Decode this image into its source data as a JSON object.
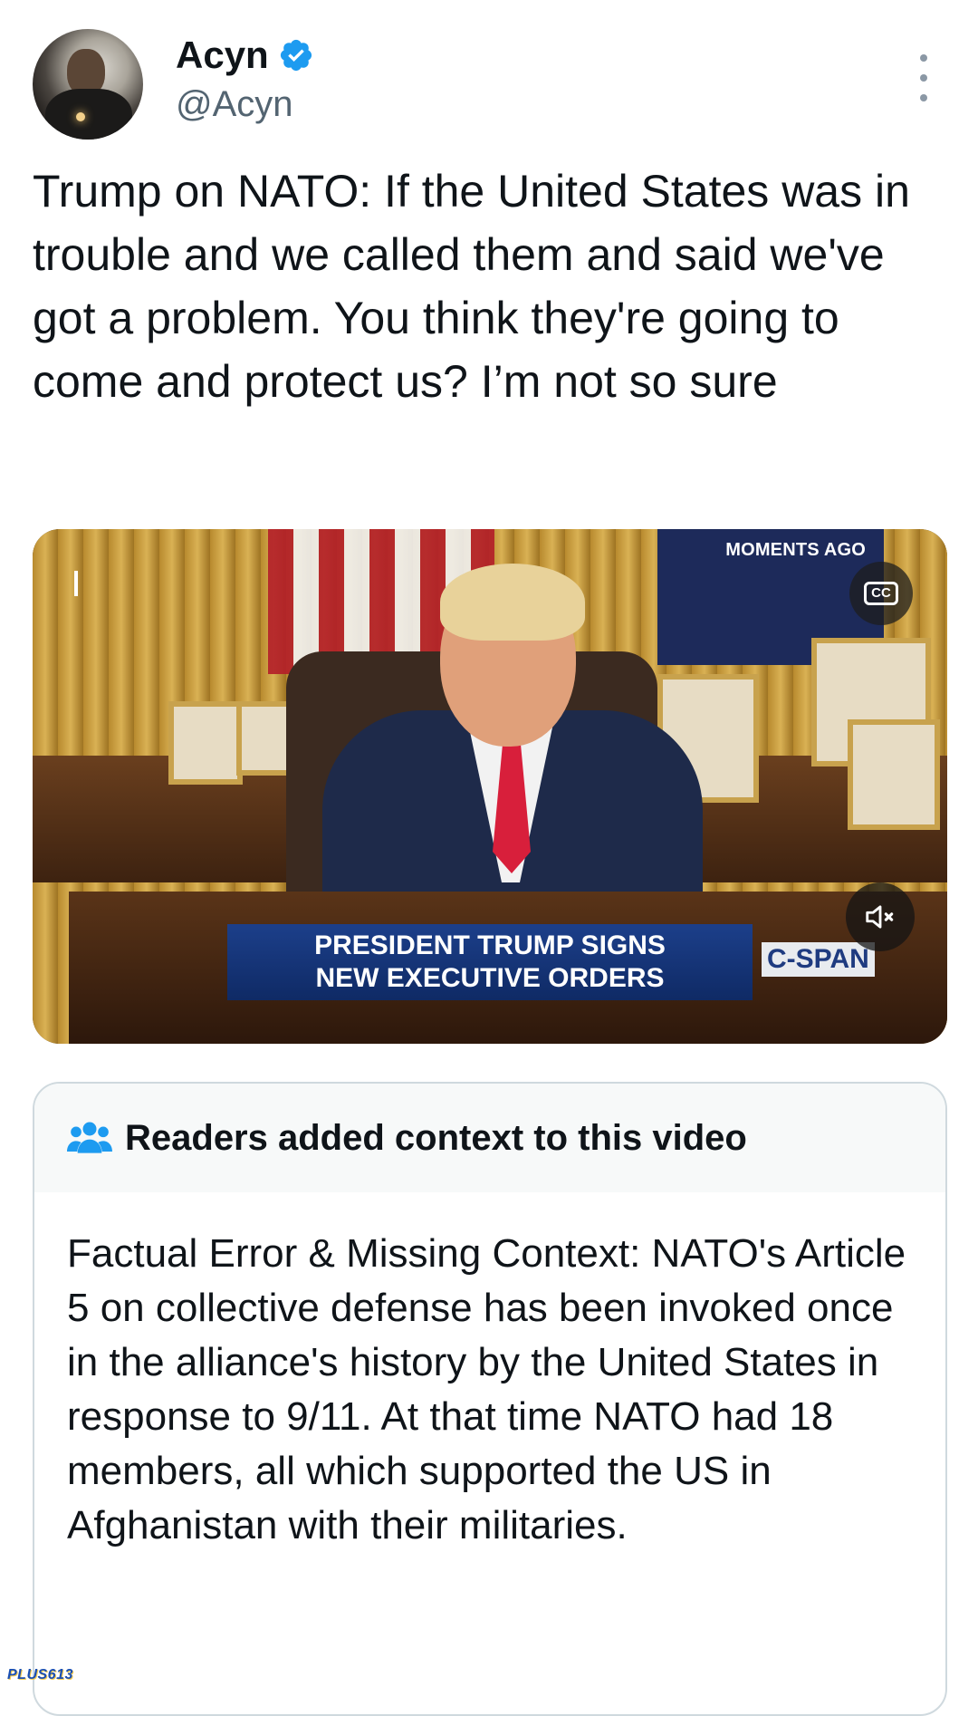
{
  "user": {
    "display_name": "Acyn",
    "handle": "@Acyn",
    "verified": true
  },
  "tweet": {
    "text": "Trump on NATO: If the United States was in trouble and we called them and said we've got a problem. You think they're going to come and protect us? I’m not so sure"
  },
  "video": {
    "badge": "MOMENTS AGO",
    "cc_label": "CC",
    "caption_line1": "PRESIDENT TRUMP SIGNS",
    "caption_line2": "NEW EXECUTIVE ORDERS",
    "network": "C-SPAN",
    "muted": true
  },
  "community_note": {
    "header": "Readers added context to this video",
    "body": "Factual Error & Missing Context: NATO's Article 5 on collective defense has been invoked once in the alliance's history by the United States in response to 9/11. At that time NATO had 18 members, all which supported the US in Afghanistan with their militaries."
  },
  "watermark": "PLUS613",
  "colors": {
    "accent": "#1d9bf0",
    "secondary_text": "#536471",
    "note_header_bg": "#f7f9f9"
  },
  "icons": [
    "verified-badge-icon",
    "more-options-icon",
    "closed-captions-icon",
    "mute-icon",
    "readers-group-icon"
  ]
}
